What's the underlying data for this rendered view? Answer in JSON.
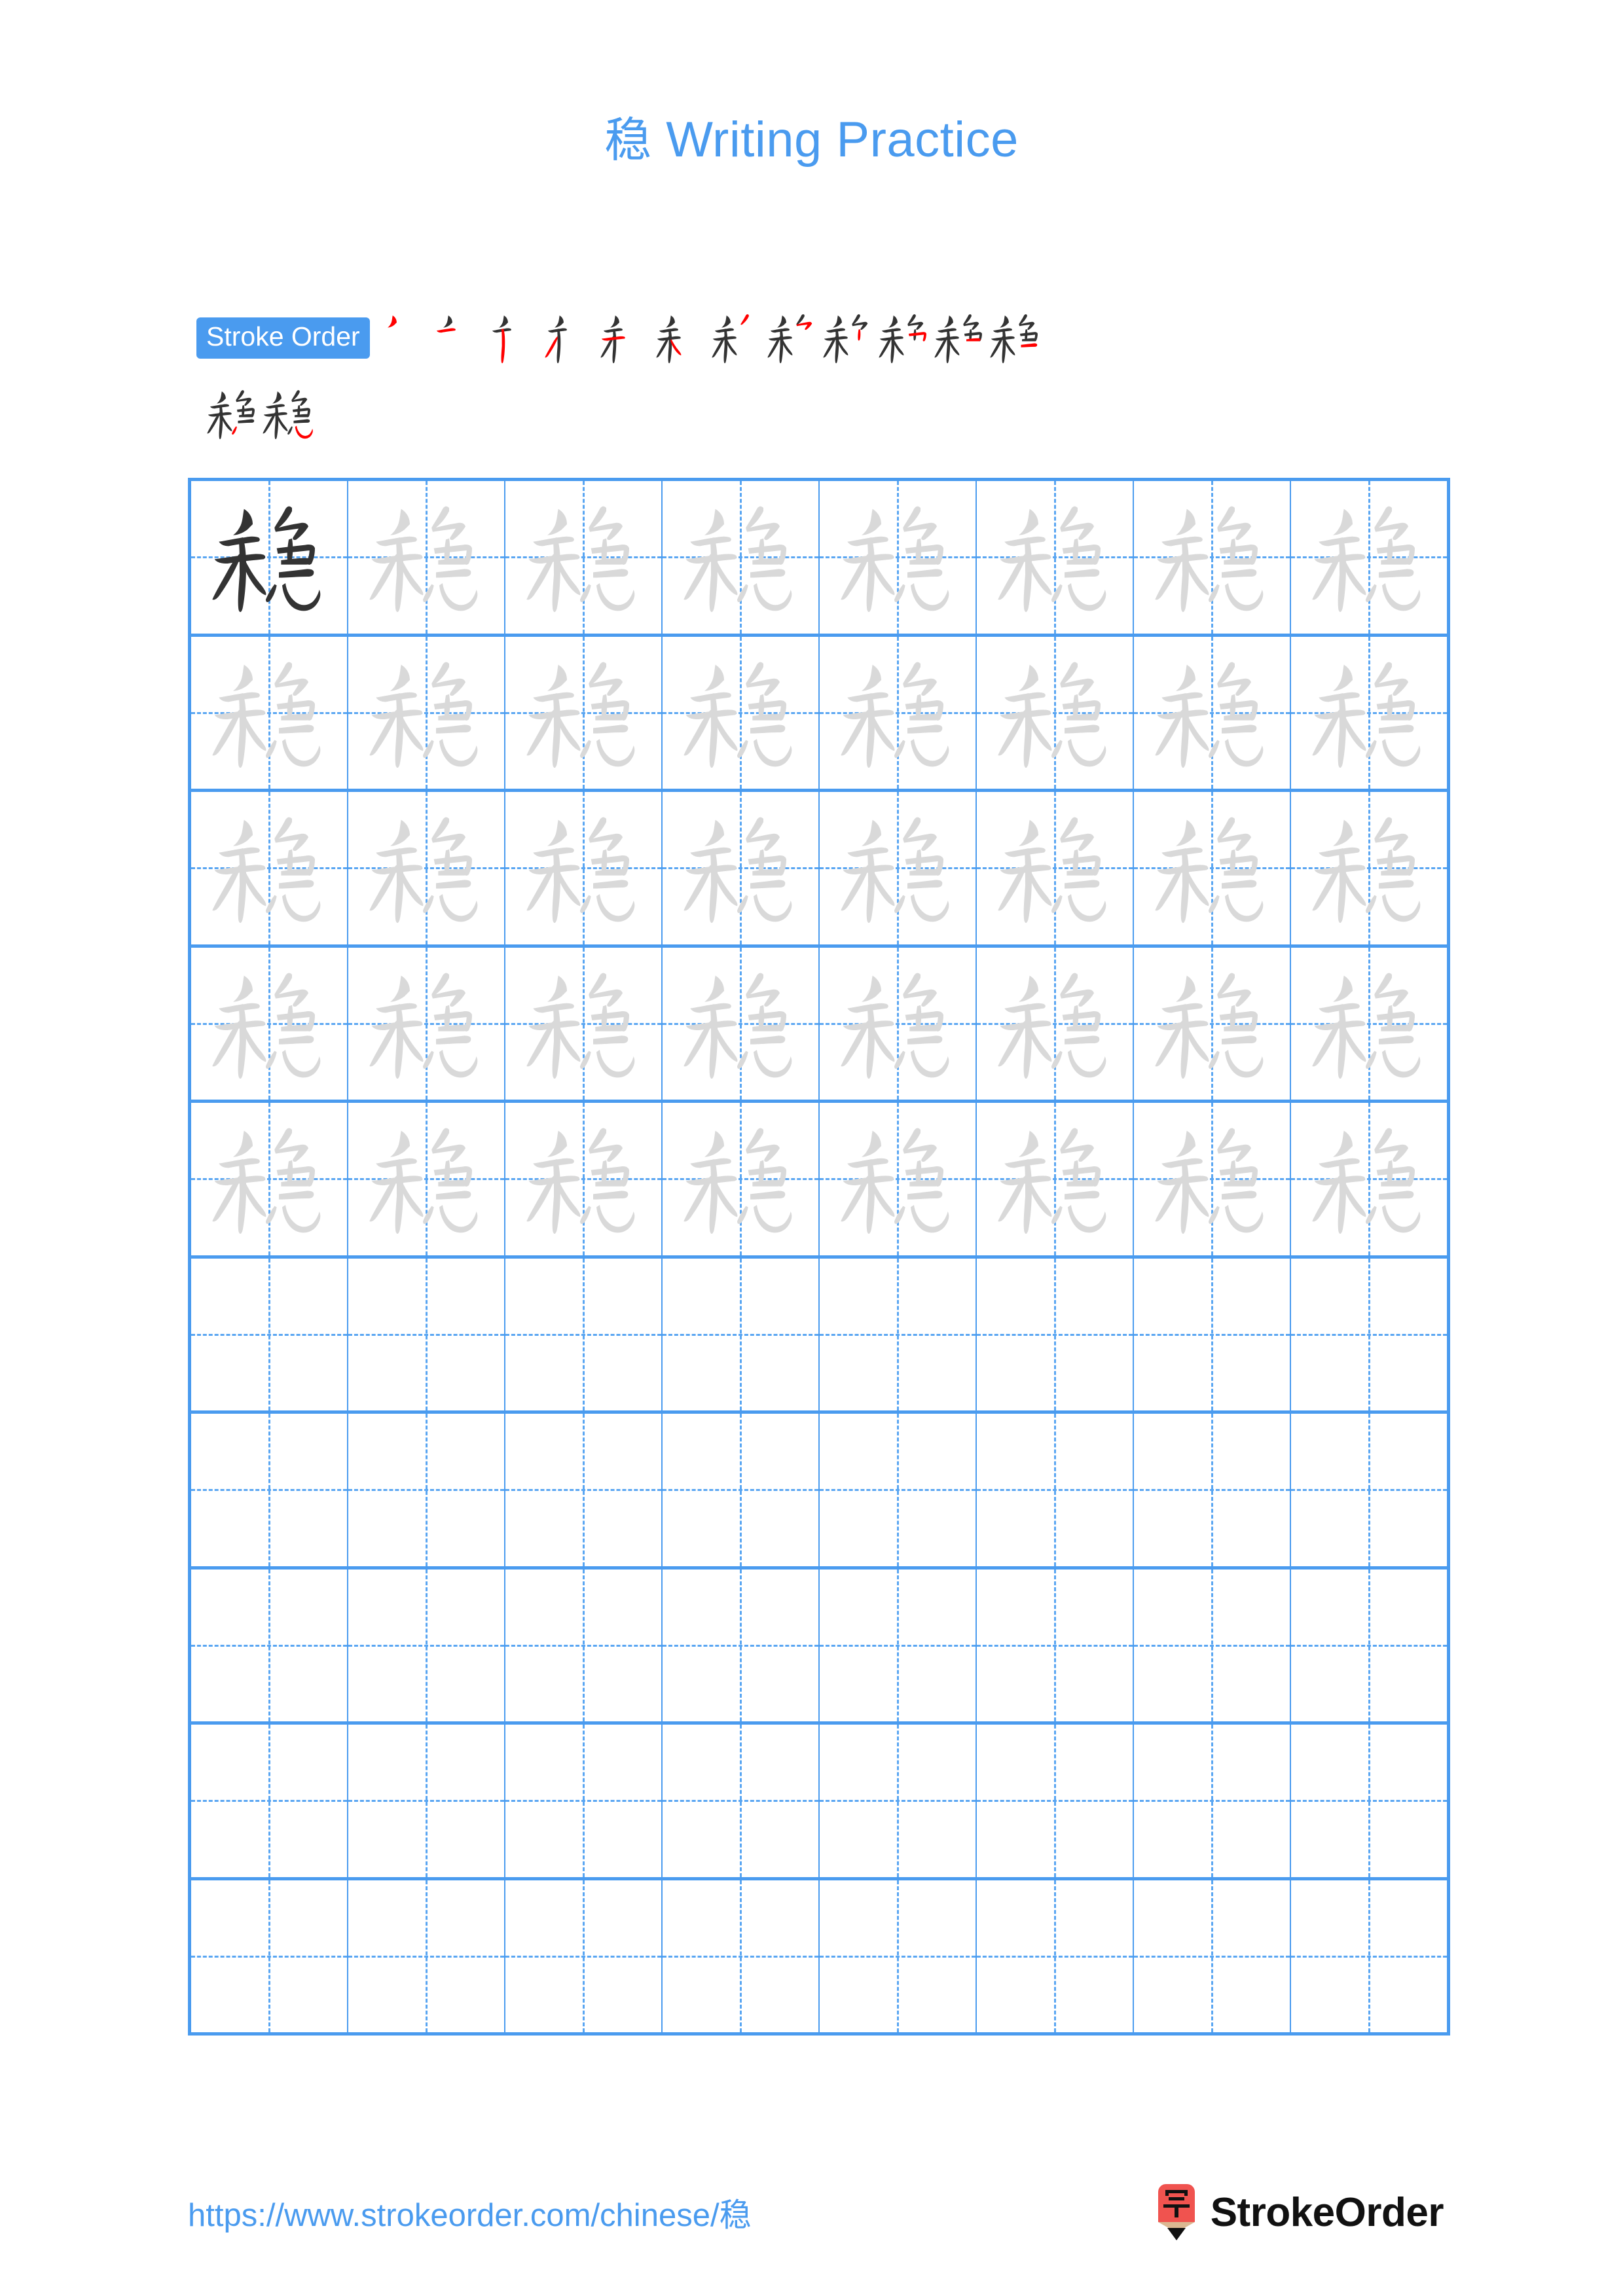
{
  "page": {
    "character": "稳",
    "background_color": "#ffffff",
    "accent_color": "#4a9bef",
    "title_prefix": "稳",
    "title_suffix": " Writing Practice",
    "title_full": "稳 Writing Practice"
  },
  "stroke_order": {
    "badge_label": "Stroke Order",
    "badge_bg": "#4a9bef",
    "badge_text_color": "#ffffff",
    "total_strokes": 14,
    "new_stroke_color": "#ff0000",
    "existing_stroke_color": "#333333",
    "frames_row1": 12,
    "frames_row2": 2,
    "frames": [
      {
        "index": 1,
        "strokes_shown": 1
      },
      {
        "index": 2,
        "strokes_shown": 2
      },
      {
        "index": 3,
        "strokes_shown": 3
      },
      {
        "index": 4,
        "strokes_shown": 4
      },
      {
        "index": 5,
        "strokes_shown": 5
      },
      {
        "index": 6,
        "strokes_shown": 6
      },
      {
        "index": 7,
        "strokes_shown": 7
      },
      {
        "index": 8,
        "strokes_shown": 8
      },
      {
        "index": 9,
        "strokes_shown": 9
      },
      {
        "index": 10,
        "strokes_shown": 10
      },
      {
        "index": 11,
        "strokes_shown": 11
      },
      {
        "index": 12,
        "strokes_shown": 12
      },
      {
        "index": 13,
        "strokes_shown": 13
      },
      {
        "index": 14,
        "strokes_shown": 14
      }
    ]
  },
  "grid": {
    "columns": 8,
    "rows": 10,
    "filled_rows": 5,
    "empty_rows": 5,
    "border_color": "#4a9bef",
    "guide_color": "#5aa6f2",
    "model_char_color": "#333333",
    "trace_char_color": "#d9d9d9",
    "cells": [
      [
        {
          "char": "稳",
          "style": "dark"
        },
        {
          "char": "稳",
          "style": "light"
        },
        {
          "char": "稳",
          "style": "light"
        },
        {
          "char": "稳",
          "style": "light"
        },
        {
          "char": "稳",
          "style": "light"
        },
        {
          "char": "稳",
          "style": "light"
        },
        {
          "char": "稳",
          "style": "light"
        },
        {
          "char": "稳",
          "style": "light"
        }
      ],
      [
        {
          "char": "稳",
          "style": "light"
        },
        {
          "char": "稳",
          "style": "light"
        },
        {
          "char": "稳",
          "style": "light"
        },
        {
          "char": "稳",
          "style": "light"
        },
        {
          "char": "稳",
          "style": "light"
        },
        {
          "char": "稳",
          "style": "light"
        },
        {
          "char": "稳",
          "style": "light"
        },
        {
          "char": "稳",
          "style": "light"
        }
      ],
      [
        {
          "char": "稳",
          "style": "light"
        },
        {
          "char": "稳",
          "style": "light"
        },
        {
          "char": "稳",
          "style": "light"
        },
        {
          "char": "稳",
          "style": "light"
        },
        {
          "char": "稳",
          "style": "light"
        },
        {
          "char": "稳",
          "style": "light"
        },
        {
          "char": "稳",
          "style": "light"
        },
        {
          "char": "稳",
          "style": "light"
        }
      ],
      [
        {
          "char": "稳",
          "style": "light"
        },
        {
          "char": "稳",
          "style": "light"
        },
        {
          "char": "稳",
          "style": "light"
        },
        {
          "char": "稳",
          "style": "light"
        },
        {
          "char": "稳",
          "style": "light"
        },
        {
          "char": "稳",
          "style": "light"
        },
        {
          "char": "稳",
          "style": "light"
        },
        {
          "char": "稳",
          "style": "light"
        }
      ],
      [
        {
          "char": "稳",
          "style": "light"
        },
        {
          "char": "稳",
          "style": "light"
        },
        {
          "char": "稳",
          "style": "light"
        },
        {
          "char": "稳",
          "style": "light"
        },
        {
          "char": "稳",
          "style": "light"
        },
        {
          "char": "稳",
          "style": "light"
        },
        {
          "char": "稳",
          "style": "light"
        },
        {
          "char": "稳",
          "style": "light"
        }
      ],
      [
        {
          "char": "",
          "style": "empty"
        },
        {
          "char": "",
          "style": "empty"
        },
        {
          "char": "",
          "style": "empty"
        },
        {
          "char": "",
          "style": "empty"
        },
        {
          "char": "",
          "style": "empty"
        },
        {
          "char": "",
          "style": "empty"
        },
        {
          "char": "",
          "style": "empty"
        },
        {
          "char": "",
          "style": "empty"
        }
      ],
      [
        {
          "char": "",
          "style": "empty"
        },
        {
          "char": "",
          "style": "empty"
        },
        {
          "char": "",
          "style": "empty"
        },
        {
          "char": "",
          "style": "empty"
        },
        {
          "char": "",
          "style": "empty"
        },
        {
          "char": "",
          "style": "empty"
        },
        {
          "char": "",
          "style": "empty"
        },
        {
          "char": "",
          "style": "empty"
        }
      ],
      [
        {
          "char": "",
          "style": "empty"
        },
        {
          "char": "",
          "style": "empty"
        },
        {
          "char": "",
          "style": "empty"
        },
        {
          "char": "",
          "style": "empty"
        },
        {
          "char": "",
          "style": "empty"
        },
        {
          "char": "",
          "style": "empty"
        },
        {
          "char": "",
          "style": "empty"
        },
        {
          "char": "",
          "style": "empty"
        }
      ],
      [
        {
          "char": "",
          "style": "empty"
        },
        {
          "char": "",
          "style": "empty"
        },
        {
          "char": "",
          "style": "empty"
        },
        {
          "char": "",
          "style": "empty"
        },
        {
          "char": "",
          "style": "empty"
        },
        {
          "char": "",
          "style": "empty"
        },
        {
          "char": "",
          "style": "empty"
        },
        {
          "char": "",
          "style": "empty"
        }
      ],
      [
        {
          "char": "",
          "style": "empty"
        },
        {
          "char": "",
          "style": "empty"
        },
        {
          "char": "",
          "style": "empty"
        },
        {
          "char": "",
          "style": "empty"
        },
        {
          "char": "",
          "style": "empty"
        },
        {
          "char": "",
          "style": "empty"
        },
        {
          "char": "",
          "style": "empty"
        },
        {
          "char": "",
          "style": "empty"
        }
      ]
    ]
  },
  "footer": {
    "url": "https://www.strokeorder.com/chinese/稳",
    "url_color": "#4a9bef",
    "brand_name": "StrokeOrder",
    "brand_logo_char": "字",
    "brand_logo_color": "#f0534f",
    "brand_logo_body_color": "#dbb892"
  }
}
